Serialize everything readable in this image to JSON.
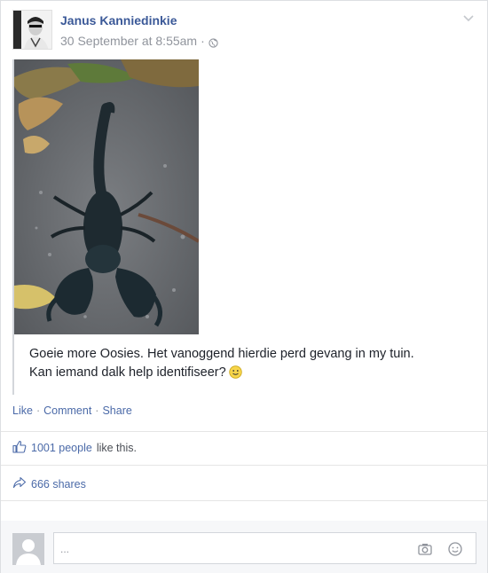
{
  "post": {
    "author": "Janus Kanniedinkie",
    "timestamp": "30 September at 8:55am",
    "dot": "·",
    "text_line1": "Goeie more Oosies. Het vanoggend hierdie perd gevang in my tuin.",
    "text_line2": "Kan iemand dalk help identifiseer?"
  },
  "actions": {
    "like": "Like",
    "comment": "Comment",
    "share": "Share",
    "sep": "·"
  },
  "stats": {
    "likes_link": "1001 people",
    "likes_suffix": "like this.",
    "shares": "666 shares"
  },
  "comment": {
    "placeholder": "..."
  },
  "colors": {
    "link": "#3b5998",
    "muted": "#90949c"
  },
  "icons": {
    "privacy": "globe-icon",
    "menu": "chevron-down-icon",
    "like": "thumbs-up-icon",
    "share": "share-arrow-icon",
    "camera": "camera-icon",
    "emoji": "smiley-icon"
  }
}
